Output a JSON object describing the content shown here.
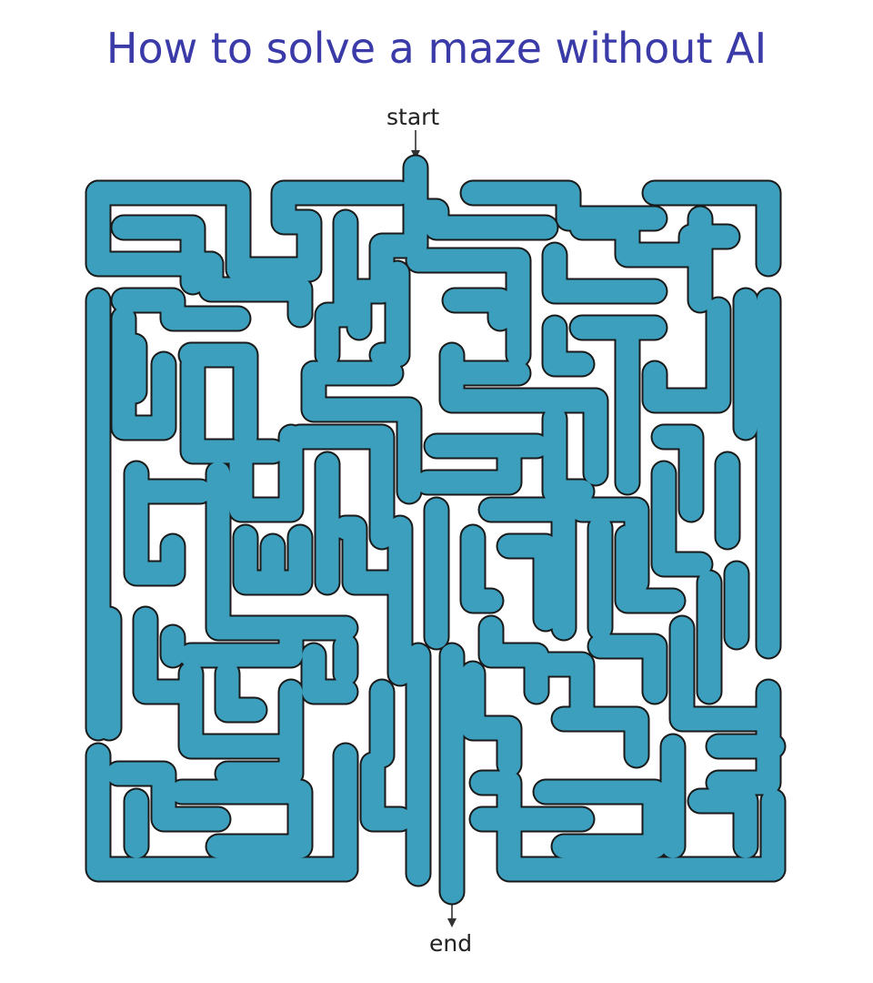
{
  "title": "How to solve a maze without AI",
  "maze": {
    "start_label": "start",
    "end_label": "end",
    "path_color": "#3c9fbd",
    "wall_color": "#1a1a1a",
    "background_color": "#ffffff"
  }
}
